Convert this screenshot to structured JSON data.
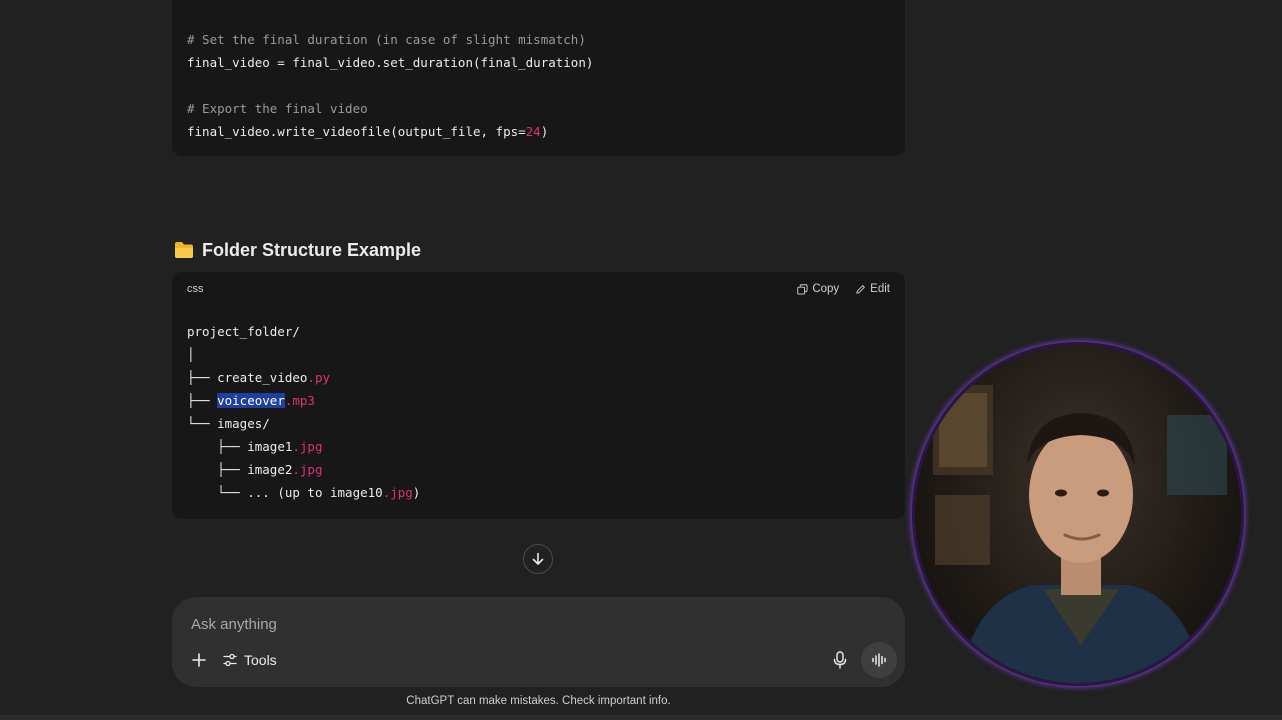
{
  "top_code": {
    "lines": [
      {
        "comment": "# Set the final duration (in case of slight mismatch)"
      },
      {
        "text": "final_video = final_video.set_duration(final_duration)"
      },
      {
        "text": ""
      },
      {
        "comment": "# Export the final video"
      },
      {
        "text_before": "final_video.write_videofile(output_file, fps=",
        "number": "24",
        "text_after": ")"
      }
    ]
  },
  "section": {
    "title": "Folder Structure Example"
  },
  "code_block": {
    "language": "css",
    "copy_label": "Copy",
    "edit_label": "Edit",
    "tree": {
      "root": "project_folder/",
      "pipe": "│",
      "item1_prefix": "├── ",
      "item1_name": "create_video",
      "item1_ext": ".py",
      "item2_prefix": "├── ",
      "item2_name": "voiceover",
      "item2_ext": ".mp3",
      "item3_prefix": "└── ",
      "item3_name": "images/",
      "sub1_prefix": "    ├── ",
      "sub1_name": "image1",
      "sub1_ext": ".jpg",
      "sub2_prefix": "    ├── ",
      "sub2_name": "image2",
      "sub2_ext": ".jpg",
      "sub3_prefix": "    └── ",
      "sub3_name": "... (up to image10",
      "sub3_ext": ".jpg",
      "sub3_tail": ")"
    }
  },
  "composer": {
    "placeholder": "Ask anything",
    "tools_label": "Tools"
  },
  "disclaimer": "ChatGPT can make mistakes. Check important info.",
  "icons": {
    "folder": "folder-icon",
    "copy": "copy-icon",
    "edit": "edit-icon",
    "scroll": "arrow-down-icon",
    "plus": "plus-icon",
    "tools": "sliders-icon",
    "mic": "microphone-icon",
    "voice": "voice-mode-icon"
  },
  "colors": {
    "background": "#212121",
    "code_background": "#171717",
    "accent_pink": "#df3079",
    "selection": "#1e3f9e"
  }
}
